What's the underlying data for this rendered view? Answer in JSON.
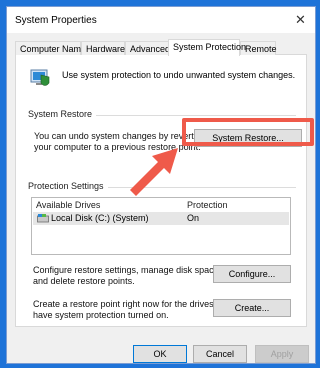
{
  "window": {
    "title": "System Properties",
    "close_glyph": "✕"
  },
  "tabs": [
    {
      "label": "Computer Name"
    },
    {
      "label": "Hardware"
    },
    {
      "label": "Advanced"
    },
    {
      "label": "System Protection",
      "active": true
    },
    {
      "label": "Remote"
    }
  ],
  "intro": "Use system protection to undo unwanted system changes.",
  "restore": {
    "group_label": "System Restore",
    "line1": "You can undo system changes by reverting",
    "line2": "your computer to a previous restore point.",
    "button": "System Restore..."
  },
  "protection": {
    "group_label": "Protection Settings",
    "col_drives": "Available Drives",
    "col_protection": "Protection",
    "rows": [
      {
        "drive": "Local Disk (C:) (System)",
        "protection": "On"
      }
    ]
  },
  "configure": {
    "line1": "Configure restore settings, manage disk space,",
    "line2": "and delete restore points.",
    "button": "Configure..."
  },
  "create": {
    "line1": "Create a restore point right now for the drives that",
    "line2": "have system protection turned on.",
    "button": "Create..."
  },
  "footer": {
    "ok": "OK",
    "cancel": "Cancel",
    "apply": "Apply"
  },
  "colors": {
    "highlight": "#ef5a4a",
    "background": "#1e73d8"
  }
}
